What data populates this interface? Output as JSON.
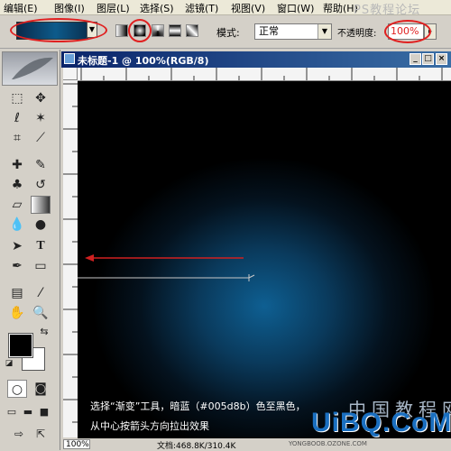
{
  "menu": [
    "编辑(E)",
    "图像(I)",
    "图层(L)",
    "选择(S)",
    "滤镜(T)",
    "视图(V)",
    "窗口(W)",
    "帮助(H)"
  ],
  "options": {
    "mode_label": "模式:",
    "mode_value": "正常",
    "opacity_label": "不透明度:",
    "opacity_value": "100%",
    "highlight_color": "#e02020"
  },
  "gradient": {
    "start_color": "#005d8b",
    "end_color": "#000000"
  },
  "document": {
    "title": "未标题-1 @ 100%(RGB/8)",
    "zoom": "100%",
    "doc_info": "文档:468.8K/310.4K"
  },
  "tutorial": {
    "caption_line1": "选择“渐变”工具，暗蓝（#005d8b）色至黑色，",
    "caption_line2": "从中心按箭头方向拉出效果",
    "arrow_color": "#d02020"
  },
  "watermarks": {
    "top": "PS教程论坛",
    "bottom_cn": "中国教程网",
    "bottom_brand": "UiBQ.CoM",
    "bottom_small": "YONGBOOB.OZONE.COM"
  },
  "icons": [
    "marquee-icon",
    "move-icon",
    "lasso-icon",
    "magic-wand-icon",
    "crop-icon",
    "slice-icon",
    "healing-icon",
    "brush-icon",
    "stamp-icon",
    "history-brush-icon",
    "eraser-icon",
    "gradient-icon",
    "blur-icon",
    "dodge-icon",
    "path-select-icon",
    "type-icon",
    "pen-icon",
    "shape-icon",
    "notes-icon",
    "eyedropper-icon",
    "hand-icon",
    "zoom-icon"
  ]
}
